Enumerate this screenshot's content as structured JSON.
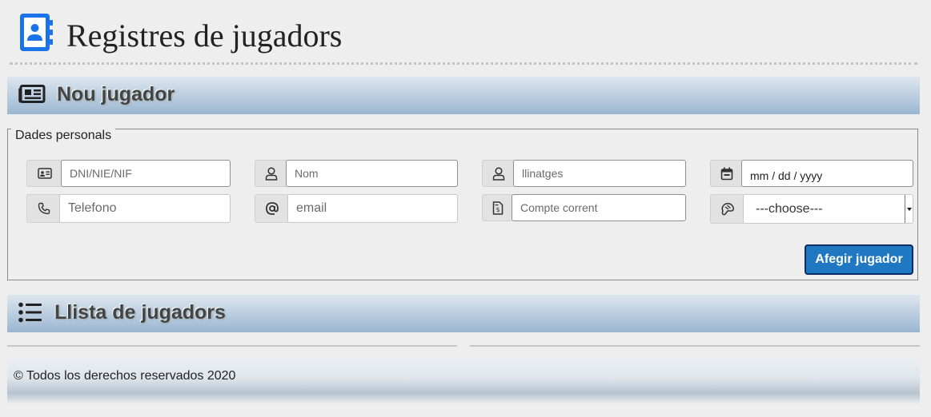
{
  "header": {
    "title": "Registres de jugadors",
    "icon": "address-book-icon",
    "accent": "#1a73e8"
  },
  "new_player": {
    "title": "Nou jugador",
    "icon": "newspaper-icon",
    "fieldset": {
      "legend": "Dades personals",
      "fields": {
        "dni": {
          "placeholder": "DNI/NIE/NIF",
          "icon": "id-card-icon"
        },
        "name": {
          "placeholder": "Nom",
          "icon": "user-icon"
        },
        "surname": {
          "placeholder": "llinatges",
          "icon": "user-icon"
        },
        "birthdate": {
          "placeholder": "mm / dd / yyyy",
          "icon": "calendar-icon"
        },
        "phone": {
          "placeholder": "Telefono",
          "icon": "phone-icon"
        },
        "email": {
          "placeholder": "email",
          "icon": "at-icon"
        },
        "account": {
          "placeholder": "Compte corrent",
          "icon": "invoice-icon"
        },
        "position": {
          "selected": "---choose---",
          "icon": "goalkeeper-glove-icon"
        }
      },
      "submit_label": "Afegir jugador"
    }
  },
  "player_list": {
    "title": "Llista de jugadors",
    "icon": "list-icon"
  },
  "footer": {
    "text": "© Todos los derechos reservados 2020"
  },
  "colors": {
    "button_bg": "#1f78c1",
    "button_border": "#0b2a66",
    "band_light": "#dde6ee",
    "band_dark": "#9bb6d0"
  }
}
